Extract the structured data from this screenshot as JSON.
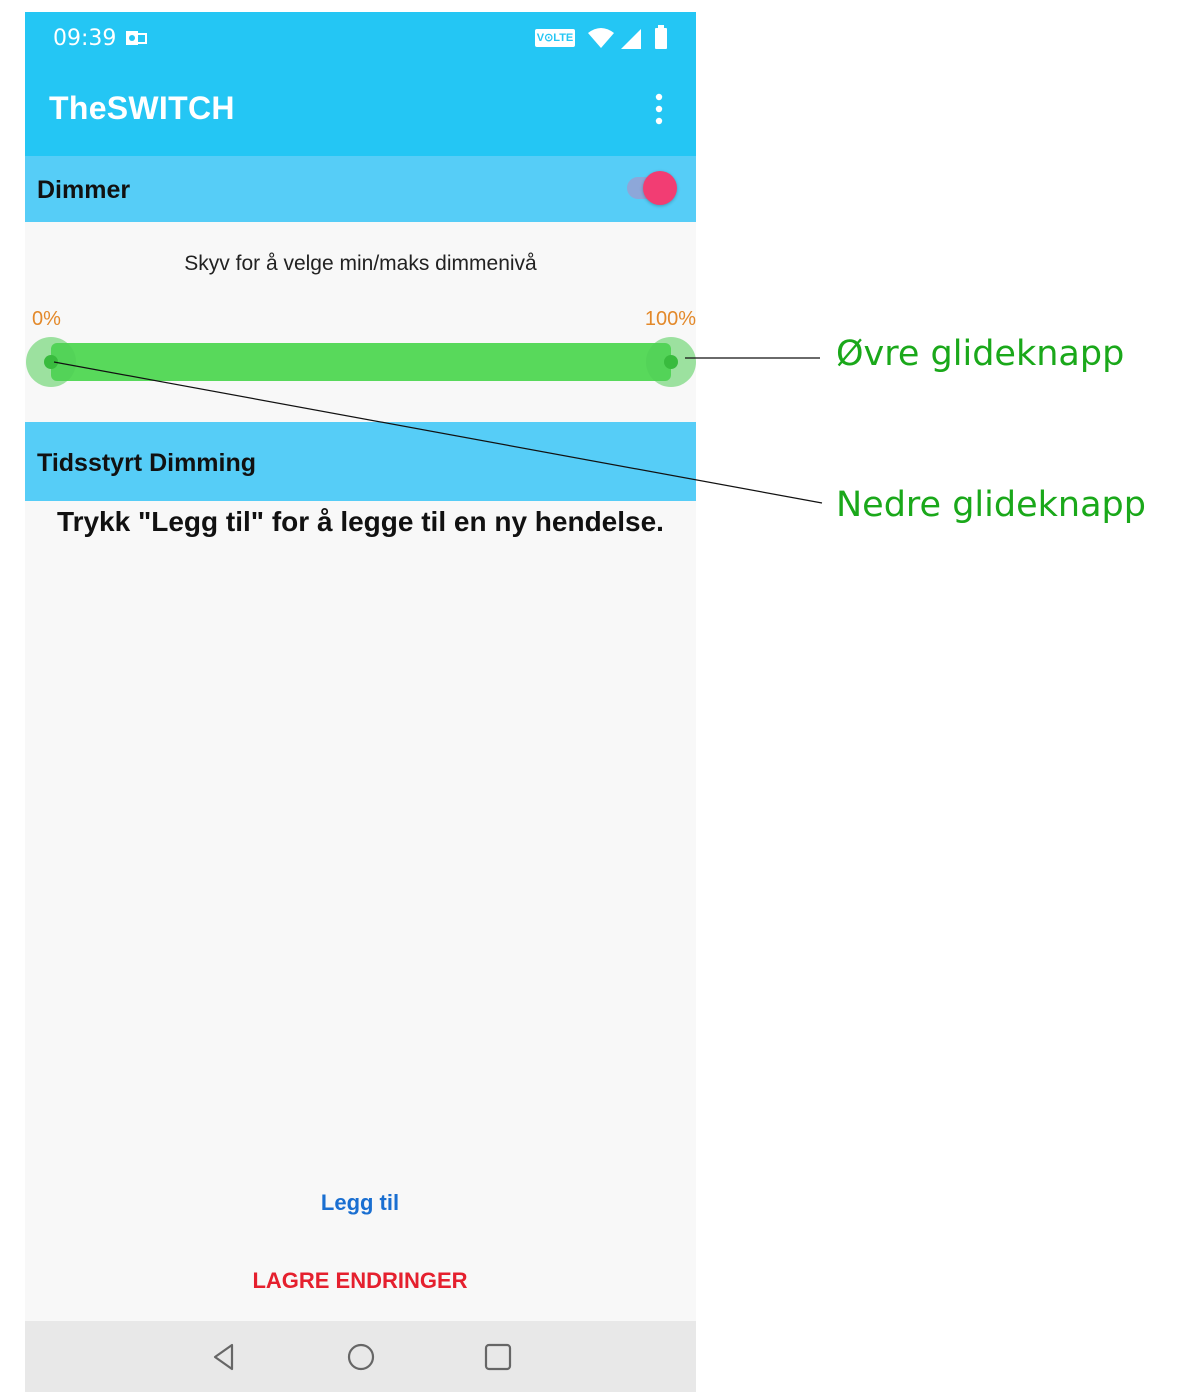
{
  "status_bar": {
    "time": "09:39",
    "network_badge": "V⊙LTE",
    "icons": [
      "outlook-notification-icon",
      "wifi-icon",
      "signal-icon",
      "battery-icon"
    ]
  },
  "app_bar": {
    "title": "TheSWITCH",
    "menu_icon": "overflow-menu-icon"
  },
  "dimmer": {
    "title": "Dimmer",
    "enabled": true,
    "hint": "Skyv for å velge min/maks dimmenivå",
    "min_label": "0%",
    "max_label": "100%",
    "lower_value_percent": 0,
    "upper_value_percent": 100
  },
  "scheduled": {
    "title": "Tidsstyrt Dimming",
    "empty_message": "Trykk \"Legg til\" for å legge til en ny hendelse."
  },
  "actions": {
    "add_label": "Legg til",
    "save_label": "LAGRE ENDRINGER"
  },
  "nav_bar": {
    "icons": [
      "back-icon",
      "home-icon",
      "recents-icon"
    ]
  },
  "callouts": {
    "upper_knob": "Øvre glideknapp",
    "lower_knob": "Nedre glideknapp"
  },
  "colors": {
    "app_bar": "#24c6f4",
    "section_header": "#56cdf7",
    "slider_fill": "#58d95b",
    "range_label": "#e3892a",
    "switch_thumb": "#f23d73",
    "add_button": "#1a6fd1",
    "save_button": "#e5202e",
    "callout_text": "#1aa81a"
  }
}
